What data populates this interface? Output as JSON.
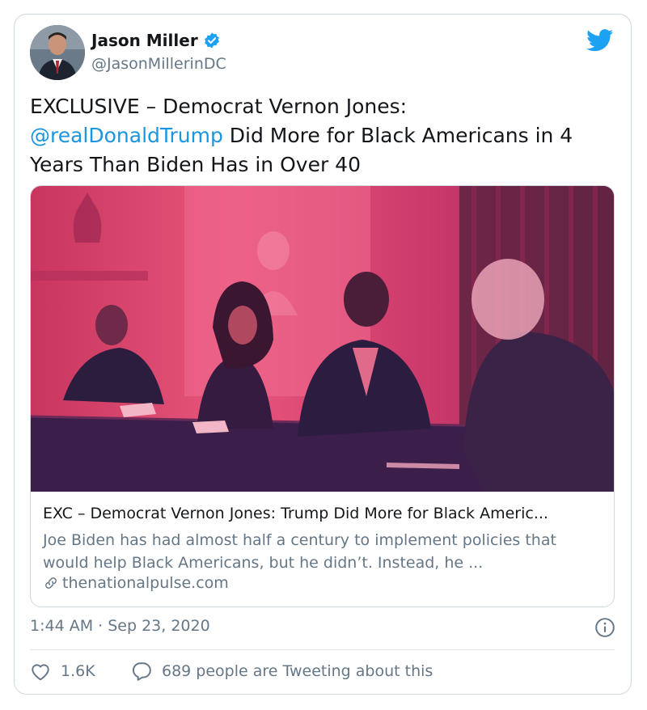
{
  "author": {
    "name": "Jason Miller",
    "handle": "@JasonMillerinDC",
    "verified": true
  },
  "tweet": {
    "text_prefix": "EXCLUSIVE – Democrat Vernon Jones:",
    "mention": "@realDonaldTrump",
    "text_suffix": " Did More for Black Americans in 4 Years Than Biden Has in Over 40"
  },
  "link_card": {
    "title": "EXC – Democrat Vernon Jones: Trump Did More for Black Americ...",
    "description": "Joe Biden has had almost half a century to implement policies that would help Black Americans, but he didn’t. Instead, he ...",
    "domain": "thenationalpulse.com"
  },
  "meta": {
    "timestamp": "1:44 AM · Sep 23, 2020"
  },
  "actions": {
    "likes": "1.6K",
    "tweeting_about": "689 people are Tweeting about this"
  },
  "colors": {
    "accent": "#1da1f2",
    "mention": "#1b95e0",
    "secondary_text": "#657786",
    "border": "#cfd9de",
    "image_tint": "#d93a6a"
  },
  "icons": {
    "verified": "verified-badge-icon",
    "brand": "twitter-bird-icon",
    "info": "info-icon",
    "like": "heart-icon",
    "reply": "speech-bubble-icon",
    "link": "link-chain-icon"
  }
}
